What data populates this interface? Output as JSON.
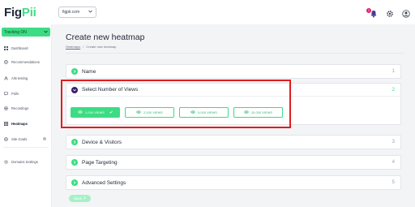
{
  "app": {
    "logo_main": "Fig",
    "logo_accent": "Pii",
    "site_select_value": "figpii.com",
    "notification_count": "1"
  },
  "sidebar": {
    "tracking_label": "Tracking ON",
    "items": [
      {
        "label": "Dashboard",
        "icon": "dashboard-icon"
      },
      {
        "label": "Recommendations",
        "icon": "recommendations-icon"
      },
      {
        "label": "A/B testing",
        "icon": "ab-testing-icon"
      },
      {
        "label": "Polls",
        "icon": "polls-icon"
      },
      {
        "label": "Recordings",
        "icon": "recordings-icon"
      },
      {
        "label": "Heatmaps",
        "icon": "heatmaps-icon",
        "active": true
      },
      {
        "label": "Site Goals",
        "icon": "site-goals-icon"
      },
      {
        "label": "Domains Settings",
        "icon": "domains-settings-icon"
      }
    ]
  },
  "main": {
    "title": "Create new heatmap",
    "breadcrumb": {
      "parent": "Heatmaps",
      "separator": "/",
      "current": "Create new heatmap"
    },
    "panels": {
      "name": {
        "title": "Name",
        "number": "1"
      },
      "views": {
        "title": "Select Number of Views",
        "number": "2",
        "options": [
          "1,000 VIEWS",
          "2,000 VIEWS",
          "5,000 VIEWS",
          "10,000 VIEWS"
        ],
        "selected_option": "1,000 VIEWS"
      },
      "device": {
        "title": "Device & Visitors",
        "number": "3"
      },
      "targeting": {
        "title": "Page Targeting",
        "number": "4"
      },
      "advanced": {
        "title": "Advanced Settings",
        "number": "5"
      }
    },
    "save_label": "Save"
  },
  "colors": {
    "brand_green": "#3ddc84",
    "brand_purple": "#3b1e6e",
    "highlight_red": "#e11d1d",
    "badge_pink": "#e11d74"
  }
}
